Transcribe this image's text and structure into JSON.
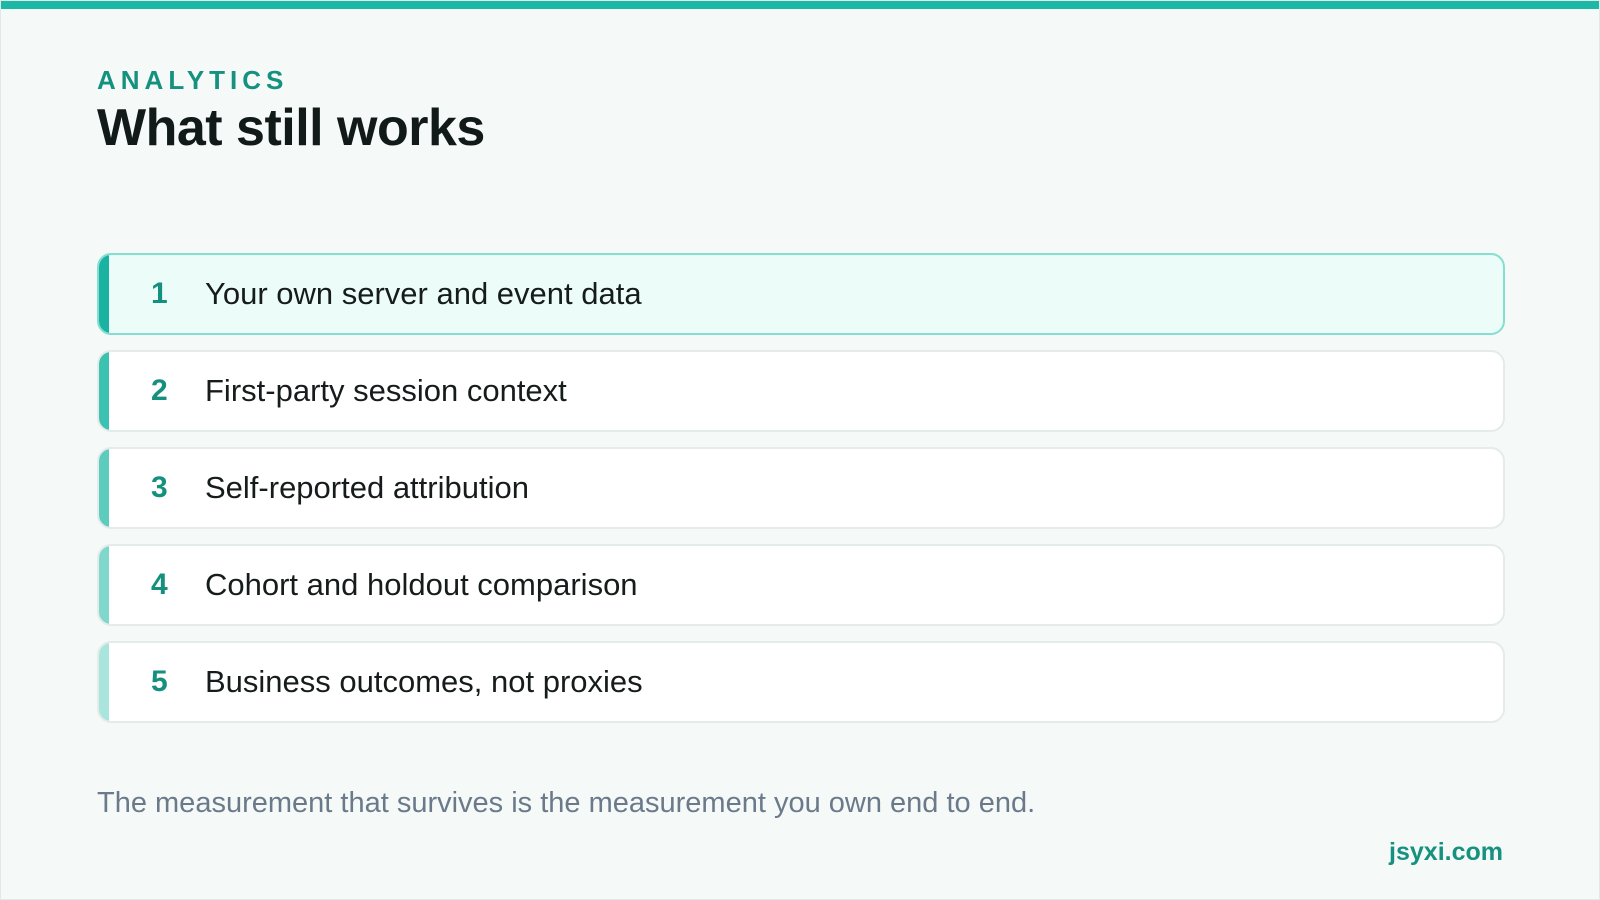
{
  "slide": {
    "eyebrow": "ANALYTICS",
    "title": "What still works",
    "footnote": "The measurement that survives is the measurement you own end to end.",
    "brand": "jsyxi.com"
  },
  "items": [
    {
      "number": "1",
      "label": "Your own server and event data",
      "active": true,
      "accent": "#1ab3a1"
    },
    {
      "number": "2",
      "label": "First-party session context",
      "active": false,
      "accent": "#3cc2b1"
    },
    {
      "number": "3",
      "label": "Self-reported attribution",
      "active": false,
      "accent": "#5cccbe"
    },
    {
      "number": "4",
      "label": "Cohort and holdout comparison",
      "active": false,
      "accent": "#80d8cd"
    },
    {
      "number": "5",
      "label": "Business outcomes, not proxies",
      "active": false,
      "accent": "#a9e5dd"
    }
  ],
  "colors": {
    "top_bar": "#1cb8a6",
    "accent_text": "#15917f",
    "background": "#f5f9f8"
  }
}
